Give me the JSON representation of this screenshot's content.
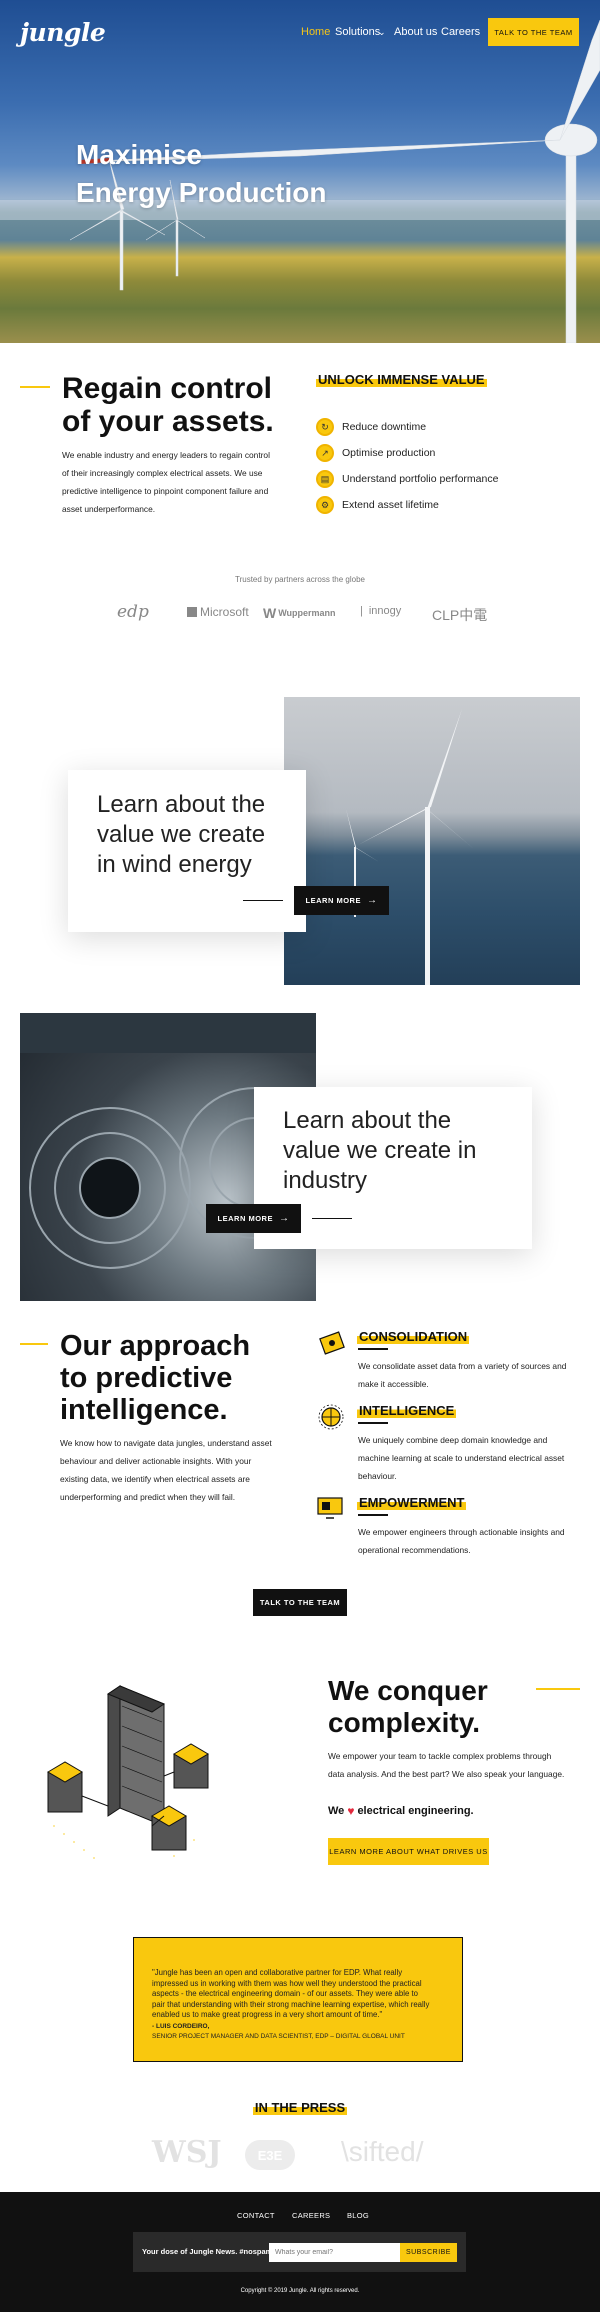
{
  "header": {
    "logo": "jungle",
    "nav": [
      "Home",
      "Solutions",
      "About us",
      "Careers"
    ],
    "cta": "TALK TO THE TEAM"
  },
  "hero": {
    "title_line1": "Maximise",
    "title_line2": "Energy Production"
  },
  "regain": {
    "title_line1": "Regain control",
    "title_line2": "of your assets.",
    "body": [
      "We enable industry and energy leaders to regain control",
      "of their increasingly complex electrical assets. We use",
      "predictive intelligence to pinpoint component failure and",
      "asset underperformance."
    ],
    "value_heading": "UNLOCK IMMENSE VALUE",
    "values": [
      "Reduce downtime",
      "Optimise production",
      "Understand portfolio performance",
      "Extend asset lifetime"
    ]
  },
  "partners": {
    "heading": "Trusted by partners across the globe",
    "logos": [
      "edp",
      "Microsoft",
      "Wuppermann",
      "innogy",
      "CLP中電"
    ]
  },
  "wind": {
    "title": [
      "Learn about the",
      "value we create",
      "in wind energy"
    ],
    "button": "LEARN MORE"
  },
  "industry": {
    "title": [
      "Learn about the",
      "value we create in",
      "industry"
    ],
    "button": "LEARN MORE"
  },
  "approach": {
    "title": [
      "Our approach",
      "to predictive",
      "intelligence."
    ],
    "body": [
      "We know how to navigate data jungles, understand asset",
      "behaviour and deliver actionable insights. With your",
      "existing data, we identify when electrical assets are",
      "underperforming and predict when they will fail."
    ],
    "items": [
      {
        "title": "CONSOLIDATION",
        "icon": "consolidation-icon",
        "text": [
          "We consolidate asset data from a variety of sources and",
          "make it accessible."
        ]
      },
      {
        "title": "INTELLIGENCE",
        "icon": "brain-icon",
        "text": [
          "We uniquely combine deep domain knowledge and",
          "machine learning at scale to understand electrical asset",
          "behaviour."
        ]
      },
      {
        "title": "EMPOWERMENT",
        "icon": "monitor-icon",
        "text": [
          "We empower engineers through actionable insights and",
          "operational recommendations."
        ]
      }
    ],
    "cta": "TALK TO THE TEAM"
  },
  "conquer": {
    "title": [
      "We conquer",
      "complexity."
    ],
    "body": [
      "We empower your team to tackle complex problems through",
      "data analysis. And the best part? We also speak your language."
    ],
    "love_prefix": "We",
    "love_suffix": "electrical engineering.",
    "button": "LEARN MORE ABOUT WHAT DRIVES US"
  },
  "quote": {
    "text": [
      "\"Jungle has been an open and collaborative partner for EDP. What really",
      "impressed us in working with them was how well they understood the practical",
      "aspects - the electrical engineering domain - of our assets. They were able to",
      "pair that understanding with their strong machine learning expertise, which really",
      "enabled us to make great progress in a very short amount of time.\""
    ],
    "author": "- LUIS CORDEIRO,",
    "role": "SENIOR PROJECT MANAGER AND DATA SCIENTIST, EDP – DIGITAL GLOBAL UNIT"
  },
  "press": {
    "heading": "IN THE PRESS",
    "logos": [
      "WSJ",
      "E3E",
      "sifted"
    ]
  },
  "footer": {
    "links": [
      "CONTACT",
      "CAREERS",
      "BLOG"
    ],
    "newsletter_label": "Your dose of Jungle News. #nospam",
    "email_placeholder": "Whats your email?",
    "subscribe": "SUBSCRIBE",
    "copyright": "Copyright © 2019 Jungle. All rights reserved."
  },
  "colors": {
    "accent": "#f9c80e",
    "dark": "#111111"
  }
}
